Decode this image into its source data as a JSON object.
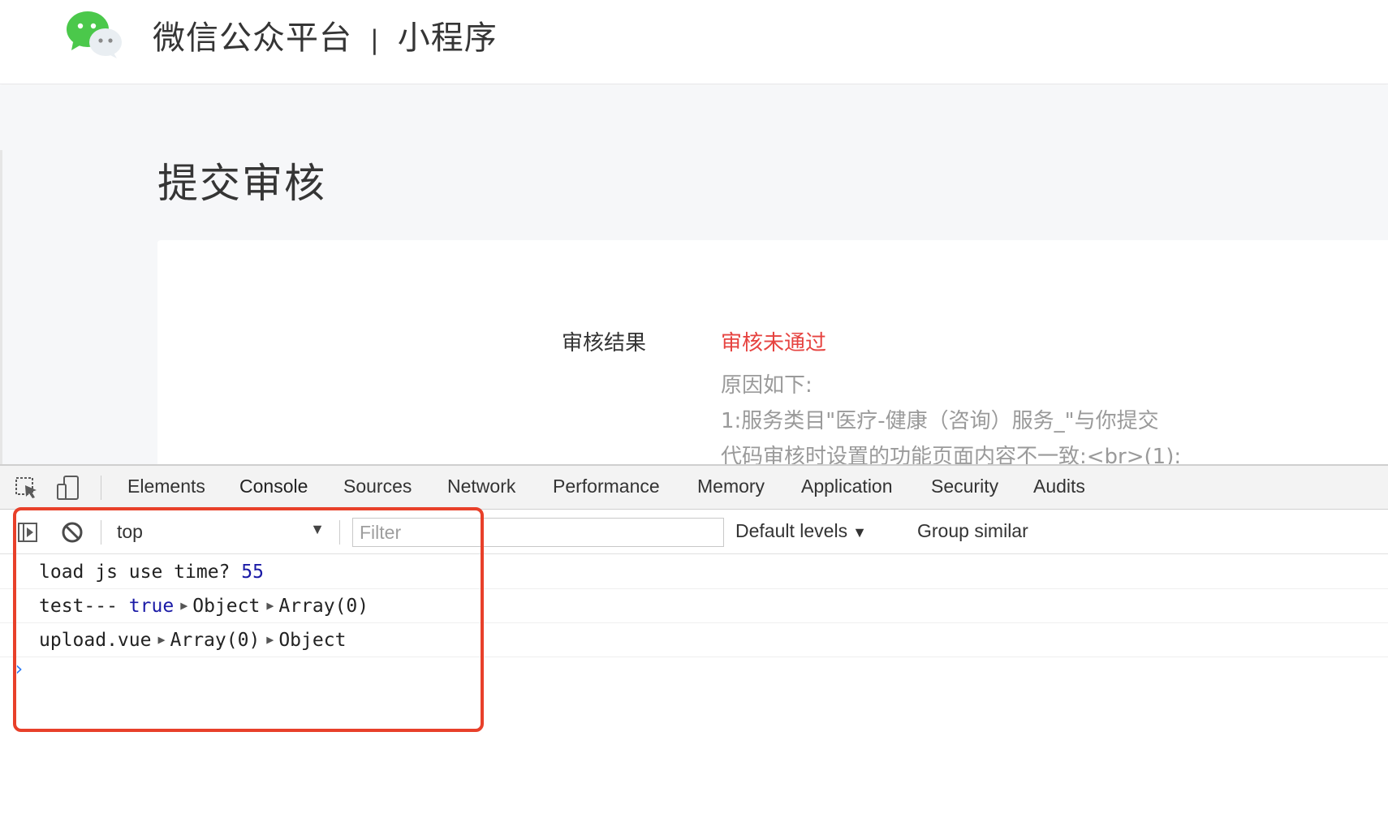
{
  "header": {
    "brand_name": "微信公众平台",
    "separator": "|",
    "section": "小程序"
  },
  "page": {
    "title": "提交审核",
    "result_label": "审核结果",
    "result_status": "审核未通过",
    "reason_heading": "原因如下:",
    "reason_line_1": "1:服务类目\"医疗-健康（咨询）服务_\"与你提交",
    "reason_line_2": "代码审核时设置的功能页面内容不一致:<br>(1):"
  },
  "devtools": {
    "tabs": [
      {
        "label": "Elements"
      },
      {
        "label": "Console"
      },
      {
        "label": "Sources"
      },
      {
        "label": "Network"
      },
      {
        "label": "Performance"
      },
      {
        "label": "Memory"
      },
      {
        "label": "Application"
      },
      {
        "label": "Security"
      },
      {
        "label": "Audits"
      }
    ],
    "active_tab": "Console",
    "toolbar": {
      "context": "top",
      "filter_placeholder": "Filter",
      "levels": "Default levels",
      "group_similar": "Group similar"
    },
    "console_lines": [
      {
        "text": "load js use time?",
        "value": "55"
      },
      {
        "text": "test---",
        "bool": "true",
        "obj1": "Object",
        "obj2": "Array(0)"
      },
      {
        "text": "upload.vue",
        "obj1": "Array(0)",
        "obj2": "Object"
      }
    ],
    "prompt": "›"
  },
  "colors": {
    "status_red": "#e64340",
    "highlight_red": "#e8402a",
    "wechat_green": "#4bc84b",
    "console_blue": "#1a1aa6"
  },
  "icons": {
    "logo": "wechat-logo-icon",
    "inspect": "inspect-element-icon",
    "device": "device-toolbar-icon",
    "sidebar": "show-sidebar-icon",
    "clear": "clear-console-icon"
  }
}
